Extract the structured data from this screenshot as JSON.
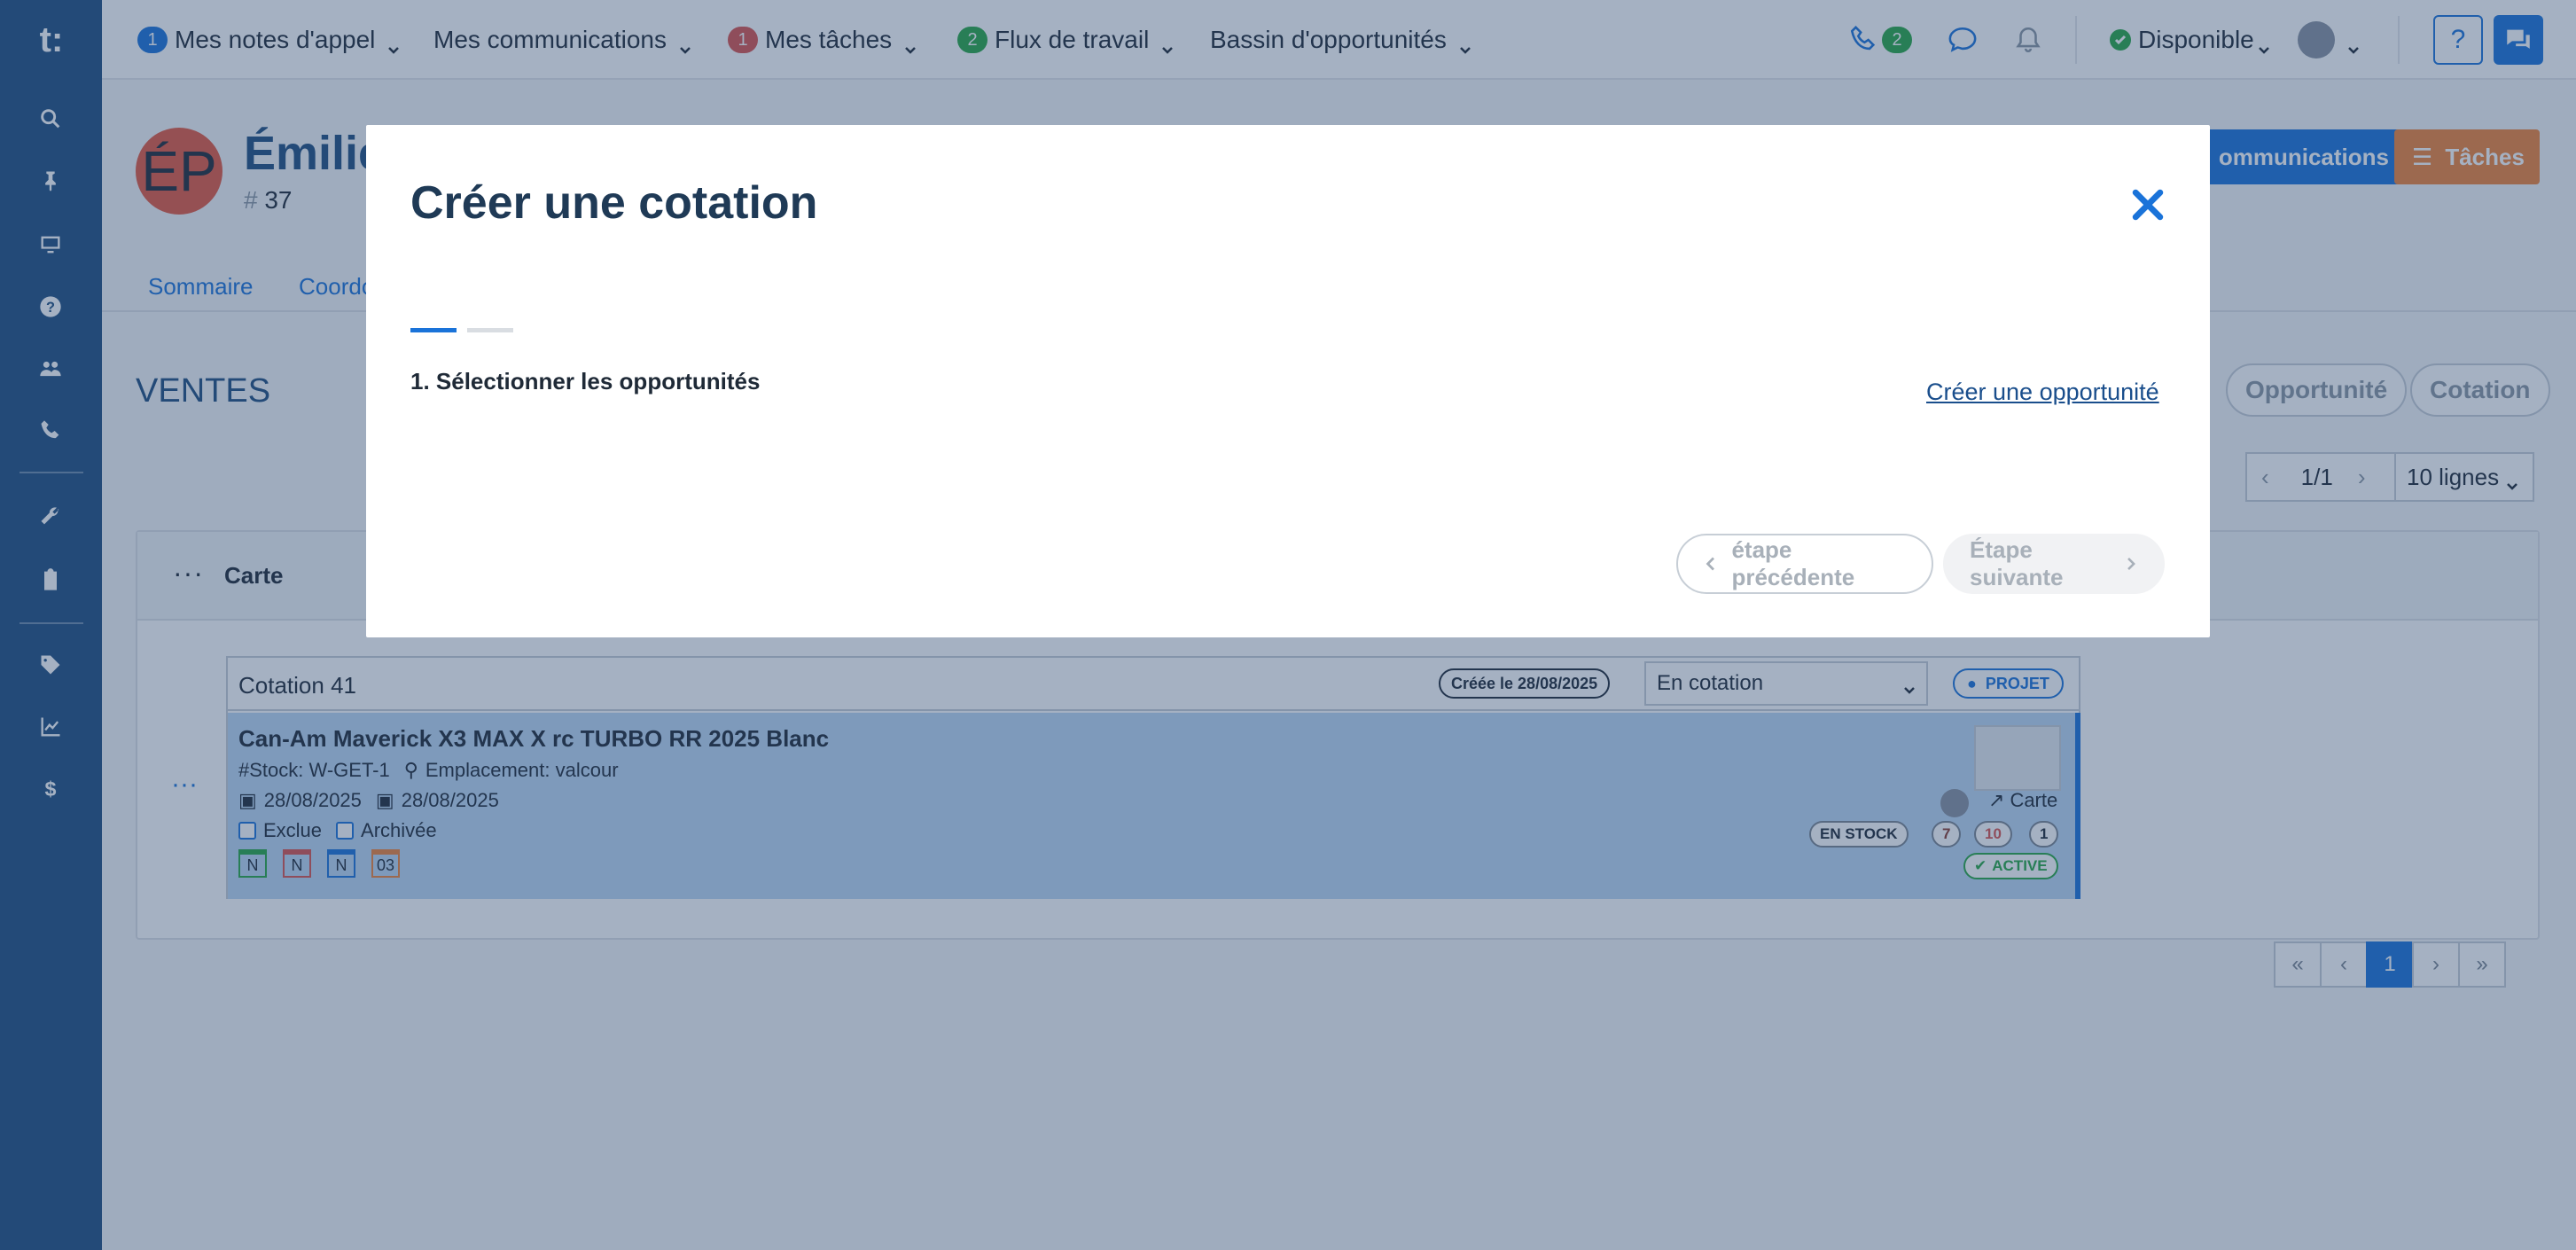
{
  "topnav": {
    "items": [
      {
        "badge": "1",
        "label": "Mes notes d'appel"
      },
      {
        "badge": "",
        "label": "Mes communications"
      },
      {
        "badge": "1",
        "label": "Mes tâches"
      },
      {
        "badge": "2",
        "label": "Flux de travail"
      },
      {
        "badge": "",
        "label": "Bassin d'opportunités"
      }
    ],
    "phone_badge": "2",
    "status_label": "Disponible",
    "help_label": "?"
  },
  "contact": {
    "initials": "ÉP",
    "name": "Émilie",
    "id": "37",
    "communications_label": "ommunications",
    "tasks_label": "Tâches"
  },
  "tabs": [
    "Sommaire",
    "Coordo"
  ],
  "sales": {
    "title": "VENTES",
    "buttons": [
      "Opportunité",
      "Cotation"
    ],
    "page_indicator": "1/1",
    "rows_label": "10 lignes",
    "card_title": "Carte"
  },
  "quote": {
    "title": "Cotation 41",
    "created": "Créée le 28/08/2025",
    "status": "En cotation",
    "badge": "PROJET",
    "item": {
      "title": "Can-Am Maverick X3 MAX X rc TURBO RR 2025 Blanc",
      "stock": "#Stock: W-GET-1",
      "location": "Emplacement: valcour",
      "date1": "28/08/2025",
      "date2": "28/08/2025",
      "check1": "Exclue",
      "check2": "Archivée",
      "cal_labels": [
        "N",
        "N",
        "N",
        "03"
      ],
      "card_link": "Carte",
      "stock_badge": "EN STOCK",
      "counts": [
        "7",
        "10",
        "1"
      ],
      "active_badge": "ACTIVE"
    }
  },
  "pagination": [
    "«",
    "‹",
    "1",
    "›",
    "»"
  ],
  "modal": {
    "title": "Créer une cotation",
    "step_label": "1. Sélectionner les opportunités",
    "create_link": "Créer une opportunité",
    "prev_label": "étape précédente",
    "next_label": "Étape suivante"
  },
  "colors": {
    "sidebar": "#1f4f80",
    "accent": "#1a73d9",
    "tasks_button": "#f0843a"
  }
}
